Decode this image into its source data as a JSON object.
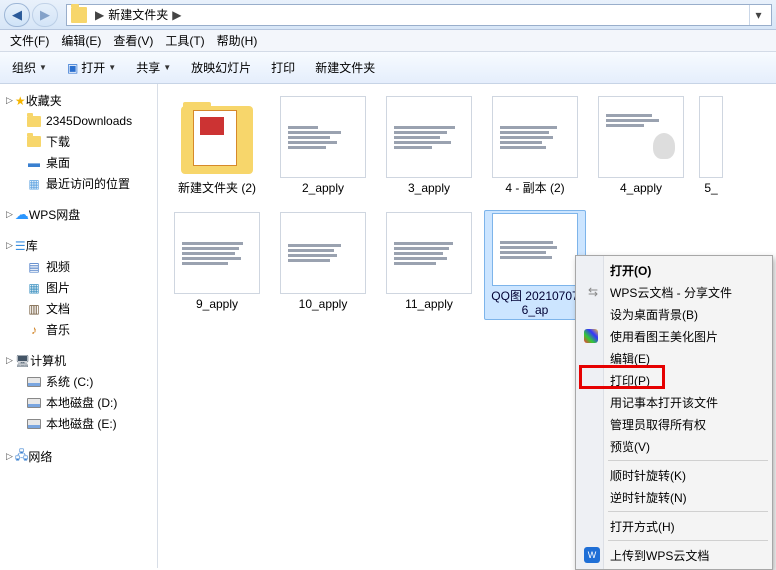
{
  "titlebar": {
    "crumb": "新建文件夹",
    "sep": "▶"
  },
  "menu": {
    "file": "文件(F)",
    "edit": "编辑(E)",
    "view": "查看(V)",
    "tools": "工具(T)",
    "help": "帮助(H)"
  },
  "toolbar": {
    "organize": "组织",
    "open": "打开",
    "share": "共享",
    "slide": "放映幻灯片",
    "print": "打印",
    "newfolder": "新建文件夹"
  },
  "sidebar": {
    "fav": "收藏夹",
    "fav_items": [
      "2345Downloads",
      "下载",
      "桌面",
      "最近访问的位置"
    ],
    "wps": "WPS网盘",
    "lib": "库",
    "lib_items": [
      "视频",
      "图片",
      "文档",
      "音乐"
    ],
    "comp": "计算机",
    "comp_items": [
      "系统 (C:)",
      "本地磁盘 (D:)",
      "本地磁盘 (E:)"
    ],
    "net": "网络"
  },
  "files": {
    "row1": [
      "新建文件夹 (2)",
      "2_apply",
      "3_apply",
      "4 - 副本 (2)",
      "4_apply",
      "5_"
    ],
    "row2": [
      "9_apply",
      "10_apply",
      "11_apply",
      "QQ图 20210707 6_ap"
    ]
  },
  "ctx": {
    "open": "打开(O)",
    "wps_share": "WPS云文档 - 分享文件",
    "set_bg": "设为桌面背景(B)",
    "beautify": "使用看图王美化图片",
    "edit": "编辑(E)",
    "print": "打印(P)",
    "notepad": "用记事本打开该文件",
    "admin": "管理员取得所有权",
    "preview": "预览(V)",
    "rot_cw": "顺时针旋转(K)",
    "rot_ccw": "逆时针旋转(N)",
    "open_way": "打开方式(H)",
    "upload": "上传到WPS云文档"
  }
}
